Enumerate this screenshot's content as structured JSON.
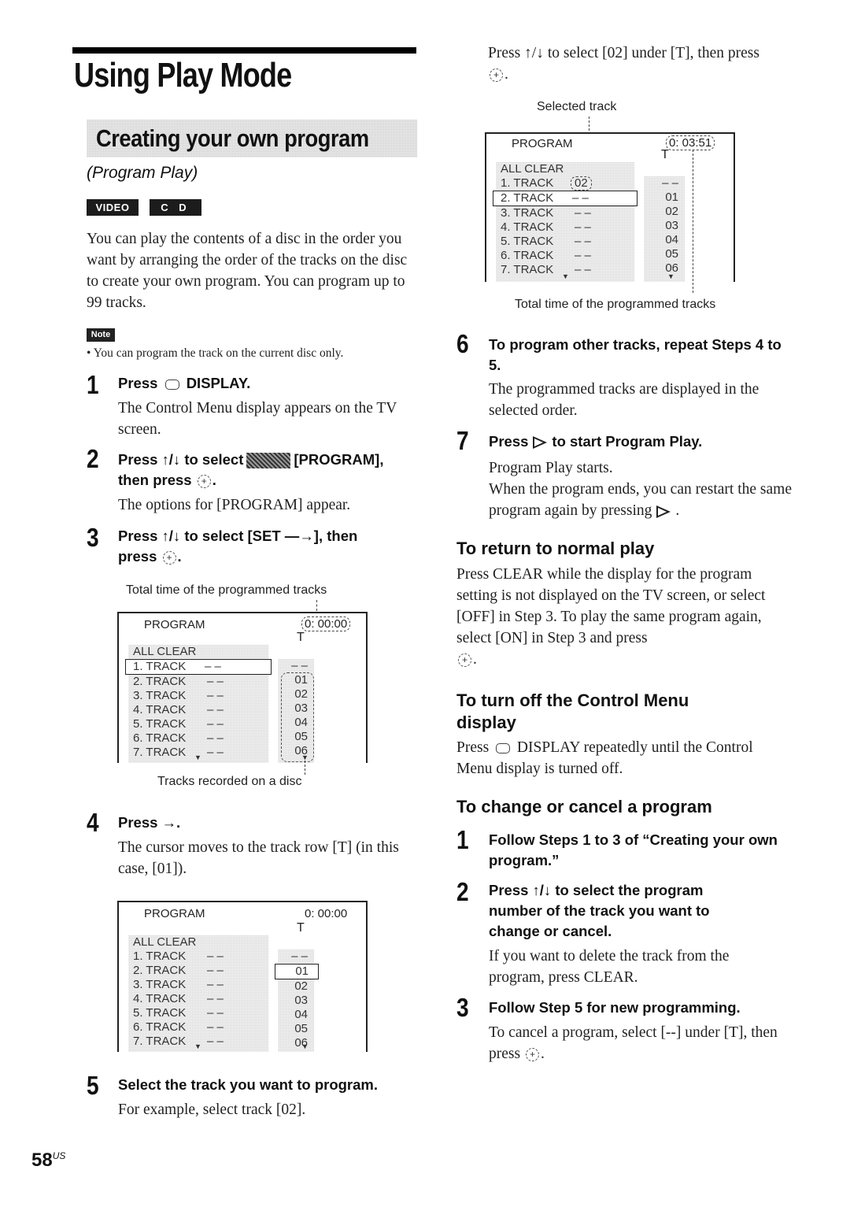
{
  "page": {
    "title": "Using Play Mode",
    "section_title": "Creating your own program",
    "subtitle": "(Program Play)",
    "badges": [
      "VIDEO CD",
      "C D"
    ],
    "intro": "You can play the contents of a disc in the order you want by arranging the order of the tracks on the disc to create your own program. You can program up to 99 tracks.",
    "note_label": "Note",
    "note_text": "• You can program the track on the current disc only.",
    "page_number": "58",
    "page_number_suffix": "US"
  },
  "steps": [
    {
      "num": "1",
      "head_pre": "Press",
      "head_post": "DISPLAY.",
      "body": "The Control Menu display appears on the TV screen."
    },
    {
      "num": "2",
      "head_pre": "Press ↑/↓ to select",
      "head_post": "[PROGRAM],",
      "head_line2": "then press",
      "body": "The options for [PROGRAM] appear."
    },
    {
      "num": "3",
      "head": "Press ↑/↓ to select [SET —→], then",
      "head_line2": "press",
      "body": ""
    },
    {
      "num": "4",
      "head": "Press →.",
      "body": "The cursor moves to the track row [T] (in this case, [01])."
    },
    {
      "num": "5",
      "head": "Select the track you want to program.",
      "body": "For example, select track [02].",
      "body2_pre": "Press ↑/↓ to select [02] under [T], then press"
    },
    {
      "num": "6",
      "head": "To program other tracks, repeat Steps 4 to 5.",
      "body": "The programmed tracks are displayed in the selected order."
    },
    {
      "num": "7",
      "head_pre": "Press",
      "head_post": "to start Program Play.",
      "body": "Program Play starts.",
      "body2_pre": "When the program ends, you can restart the same program again by pressing"
    }
  ],
  "diagrams": {
    "d1": {
      "caption_top": "Total time of the programmed tracks",
      "caption_bottom": "Tracks recorded on a disc",
      "label": "PROGRAM",
      "time": "0: 00:00",
      "t_label": "T",
      "all_clear": "ALL CLEAR",
      "rows": [
        {
          "name": "1. TRACK",
          "val": "– –"
        },
        {
          "name": "2. TRACK",
          "val": "– –"
        },
        {
          "name": "3. TRACK",
          "val": "– –"
        },
        {
          "name": "4. TRACK",
          "val": "– –"
        },
        {
          "name": "5. TRACK",
          "val": "– –"
        },
        {
          "name": "6. TRACK",
          "val": "– –"
        },
        {
          "name": "7. TRACK",
          "val": "– –"
        }
      ],
      "tracks": [
        "– –",
        "01",
        "02",
        "03",
        "04",
        "05",
        "06"
      ]
    },
    "d2": {
      "label": "PROGRAM",
      "time": "0: 00:00",
      "t_label": "T",
      "all_clear": "ALL CLEAR",
      "rows": [
        {
          "name": "1. TRACK",
          "val": "– –"
        },
        {
          "name": "2. TRACK",
          "val": "– –"
        },
        {
          "name": "3. TRACK",
          "val": "– –"
        },
        {
          "name": "4. TRACK",
          "val": "– –"
        },
        {
          "name": "5. TRACK",
          "val": "– –"
        },
        {
          "name": "6. TRACK",
          "val": "– –"
        },
        {
          "name": "7. TRACK",
          "val": "– –"
        }
      ],
      "tracks": [
        "– –",
        "01",
        "02",
        "03",
        "04",
        "05",
        "06"
      ]
    },
    "d3": {
      "caption_top": "Selected track",
      "caption_bottom": "Total time of the programmed tracks",
      "label": "PROGRAM",
      "time": "0: 03:51",
      "t_label": "T",
      "all_clear": "ALL CLEAR",
      "rows": [
        {
          "name": "1. TRACK",
          "val": "02"
        },
        {
          "name": "2. TRACK",
          "val": "– –"
        },
        {
          "name": "3. TRACK",
          "val": "– –"
        },
        {
          "name": "4. TRACK",
          "val": "– –"
        },
        {
          "name": "5. TRACK",
          "val": "– –"
        },
        {
          "name": "6. TRACK",
          "val": "– –"
        },
        {
          "name": "7. TRACK",
          "val": "– –"
        }
      ],
      "tracks": [
        "– –",
        "01",
        "02",
        "03",
        "04",
        "05",
        "06"
      ]
    }
  },
  "sections": {
    "return": {
      "heading": "To return to normal play",
      "body": "Press CLEAR while the display for the program setting is not displayed on the TV screen, or select [OFF] in Step 3. To play the same program again, select [ON] in Step 3 and press"
    },
    "turn_off": {
      "heading_line1": "To turn off the Control Menu",
      "heading_line2": "display",
      "body_pre": "Press",
      "body_post": "DISPLAY repeatedly until the Control Menu display is turned off."
    },
    "change": {
      "heading": "To change or cancel a program",
      "steps": [
        {
          "num": "1",
          "head": "Follow Steps 1 to 3 of “Creating your own program.”",
          "body": ""
        },
        {
          "num": "2",
          "head": "Press ↑/↓ to select the program number of the track you want to change or cancel.",
          "body": "If you want to delete the track from the program, press CLEAR."
        },
        {
          "num": "3",
          "head": "Follow Step 5 for new programming.",
          "body_pre": "To cancel a program, select [--] under [T], then press"
        }
      ]
    }
  },
  "icons": {
    "enter": "+",
    "period": "."
  }
}
